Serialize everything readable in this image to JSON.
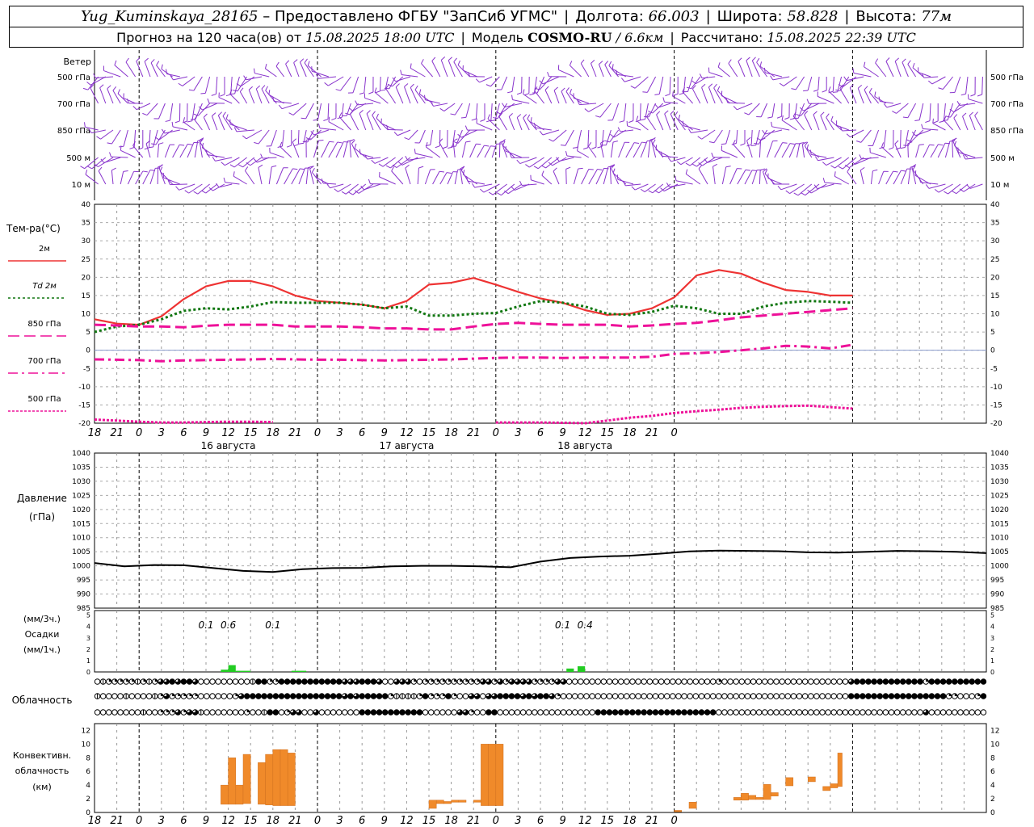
{
  "header": {
    "station": "Yug_Kuminskaya_28165",
    "provider_text": "– Предоставлено ФГБУ \"ЗапСиб УГМС\"",
    "lon_label": "Долгота:",
    "lon_value": "66.003",
    "lat_label": "Широта:",
    "lat_value": "58.828",
    "alt_label": "Высота:",
    "alt_value": "77м",
    "forecast_label": "Прогноз на 120 часа(ов) от",
    "forecast_start": "15.08.2025 18:00 UTC",
    "model_label": "Модель",
    "model_name": "COSMO-RU",
    "model_res": "/ 6.6км",
    "computed_label": "Рассчитано:",
    "computed_value": "15.08.2025 22:39 UTC"
  },
  "chart_data": [
    {
      "type": "barbs",
      "title": "Ветер",
      "levels": [
        "500 гПа",
        "700 гПа",
        "850 гПа",
        "500 м",
        "10 м"
      ]
    },
    {
      "type": "line",
      "title": "Тем-ра(°С)",
      "x": [
        18,
        21,
        24,
        27,
        30,
        33,
        36,
        39,
        42,
        45,
        48,
        51,
        54,
        57,
        60,
        63,
        66,
        69,
        72,
        75,
        78,
        81,
        84,
        87,
        90,
        93,
        96,
        99,
        102,
        105,
        108,
        111,
        114,
        117,
        120,
        123,
        126,
        129,
        132,
        135,
        138,
        141,
        144
      ],
      "ylim": [
        -20,
        40
      ],
      "yticks": [
        -20,
        -15,
        -10,
        -5,
        0,
        5,
        10,
        15,
        20,
        25,
        30,
        35,
        40
      ],
      "series": [
        {
          "name": "2м",
          "color": "#ee3333",
          "dash": "solid",
          "values": [
            8.5,
            7.3,
            7.0,
            9.3,
            14.0,
            17.5,
            19.0,
            19.0,
            17.5,
            15.0,
            13.5,
            13.0,
            12.5,
            11.5,
            13.5,
            18.0,
            18.5,
            19.8,
            18.0,
            16.0,
            14.2,
            13.0,
            11.0,
            9.7,
            10.0,
            11.5,
            14.5,
            20.5,
            22.0,
            21.0,
            18.5,
            16.5,
            16.0,
            15.0,
            15.0
          ]
        },
        {
          "name": "Td 2м",
          "color": "#117711",
          "dash": "dot",
          "values": [
            5.0,
            6.5,
            7.0,
            8.5,
            10.8,
            11.5,
            11.2,
            12.0,
            13.2,
            13.0,
            13.0,
            13.0,
            12.5,
            11.5,
            12.0,
            9.5,
            9.5,
            10.0,
            10.2,
            12.0,
            13.5,
            13.0,
            12.0,
            10.0,
            9.7,
            10.5,
            12.2,
            11.5,
            10.0,
            10.0,
            12.0,
            13.0,
            13.5,
            13.3,
            13.0
          ]
        },
        {
          "name": "850 гПа",
          "color": "#ee1199",
          "dash": "longdash",
          "values": [
            7.0,
            6.8,
            6.5,
            6.5,
            6.3,
            6.7,
            7.0,
            7.0,
            7.0,
            6.5,
            6.5,
            6.5,
            6.3,
            6.0,
            6.0,
            5.7,
            5.7,
            6.5,
            7.2,
            7.5,
            7.2,
            7.0,
            7.0,
            7.0,
            6.5,
            6.8,
            7.2,
            7.5,
            8.2,
            9.0,
            9.5,
            10.0,
            10.5,
            11.0,
            11.5
          ]
        },
        {
          "name": "700 гПа",
          "color": "#ee1199",
          "dash": "dashdot",
          "values": [
            -2.5,
            -2.6,
            -2.7,
            -3.0,
            -2.8,
            -2.7,
            -2.6,
            -2.5,
            -2.4,
            -2.5,
            -2.6,
            -2.6,
            -2.7,
            -2.8,
            -2.7,
            -2.6,
            -2.5,
            -2.3,
            -2.1,
            -2.0,
            -2.0,
            -2.1,
            -2.0,
            -2.0,
            -2.0,
            -1.8,
            -1.0,
            -0.8,
            -0.5,
            0.0,
            0.5,
            1.2,
            1.0,
            0.5,
            1.5
          ]
        },
        {
          "name": "500 гПа",
          "color": "#ee1199",
          "dash": "shortdash",
          "values": [
            -19.0,
            -19.3,
            -19.6,
            -19.8,
            -19.8,
            -19.7,
            -19.6,
            -19.6,
            -19.7,
            null,
            null,
            null,
            null,
            null,
            null,
            null,
            null,
            null,
            -19.8,
            -19.8,
            -19.8,
            -19.9,
            -20.0,
            -19.3,
            -18.5,
            -18.0,
            -17.2,
            -16.7,
            -16.3,
            -15.8,
            -15.5,
            -15.3,
            -15.2,
            -15.6,
            -16.0
          ]
        }
      ]
    },
    {
      "type": "line",
      "title": "Давление",
      "unit": "(гПа)",
      "ylim": [
        985,
        1040
      ],
      "yticks": [
        985,
        990,
        995,
        1000,
        1005,
        1010,
        1015,
        1020,
        1025,
        1030,
        1035,
        1040
      ],
      "series": [
        {
          "name": "Давление",
          "color": "#000000",
          "values": [
            1001.0,
            999.8,
            1000.3,
            1000.2,
            999.2,
            998.2,
            997.8,
            998.8,
            999.2,
            999.3,
            999.8,
            1000.0,
            1000.0,
            999.8,
            999.5,
            1001.5,
            1002.8,
            1003.3,
            1003.6,
            1004.3,
            1005.1,
            1005.4,
            1005.3,
            1005.2,
            1004.8,
            1004.7,
            1005.0,
            1005.3,
            1005.2,
            1005.0,
            1004.5
          ]
        }
      ]
    },
    {
      "type": "bar",
      "title": "Осадки",
      "unit_top": "(мм/3ч.)",
      "unit_bottom": "(мм/1ч.)",
      "ylim": [
        0,
        5
      ],
      "yticks": [
        0,
        1,
        2,
        3,
        4,
        5
      ],
      "hourly": [
        {
          "x": 35.5,
          "value": 0.2
        },
        {
          "x": 36.5,
          "value": 0.6
        },
        {
          "x": 37.5,
          "value": 0.1
        },
        {
          "x": 38.5,
          "value": 0.1
        },
        {
          "x": 45.0,
          "value": 0.1
        },
        {
          "x": 46.0,
          "value": 0.1
        },
        {
          "x": 82.0,
          "value": 0.3
        },
        {
          "x": 83.5,
          "value": 0.5
        }
      ],
      "sums_3h": [
        {
          "x": 33,
          "label": "0.1"
        },
        {
          "x": 36,
          "label": "0.6"
        },
        {
          "x": 42,
          "label": "0.1"
        },
        {
          "x": 81,
          "label": "0.1"
        },
        {
          "x": 84,
          "label": "0.4"
        }
      ]
    },
    {
      "type": "table",
      "title": "Облачность",
      "rows": [
        [
          0,
          1,
          2,
          2,
          2,
          2,
          2,
          1,
          2,
          1,
          2,
          3,
          3,
          4,
          3,
          4,
          4,
          3,
          0,
          0,
          0,
          0,
          0,
          0,
          0,
          0,
          0,
          1,
          4,
          4,
          2,
          2,
          4,
          4,
          4,
          4,
          4,
          4,
          4,
          4,
          4,
          4,
          4,
          3,
          3,
          3,
          4,
          4,
          4,
          3,
          0,
          0,
          3,
          3,
          3,
          2,
          0,
          2,
          2,
          2,
          2,
          2,
          2,
          2,
          2,
          2,
          2,
          3,
          3,
          2,
          3,
          2,
          3,
          3,
          3,
          3,
          2,
          2,
          2,
          2,
          3,
          3,
          0,
          0,
          0,
          0,
          0,
          0,
          0,
          0,
          0,
          0,
          0,
          0,
          0,
          0,
          0,
          0,
          0,
          0,
          0,
          0,
          0,
          0,
          0,
          0,
          0,
          0,
          2,
          0,
          0,
          0,
          0,
          0,
          0,
          0,
          0,
          0,
          0,
          0,
          0,
          0,
          0,
          0,
          0,
          0,
          0,
          0,
          0,
          0,
          0,
          3,
          4,
          4,
          4,
          4,
          4,
          4,
          4,
          4,
          4,
          4,
          4,
          4,
          2,
          4,
          4,
          4,
          4,
          4,
          4,
          4,
          4,
          4,
          4
        ],
        [
          1,
          0,
          0,
          0,
          0,
          1,
          0,
          0,
          0,
          0,
          1,
          2,
          3,
          2,
          2,
          2,
          2,
          2,
          0,
          0,
          0,
          0,
          0,
          0,
          2,
          3,
          4,
          4,
          4,
          4,
          4,
          4,
          4,
          4,
          4,
          4,
          4,
          4,
          4,
          4,
          4,
          4,
          4,
          3,
          4,
          3,
          4,
          4,
          4,
          4,
          4,
          2,
          1,
          1,
          1,
          1,
          2,
          4,
          2,
          2,
          2,
          4,
          2,
          0,
          0,
          3,
          3,
          0,
          3,
          3,
          4,
          4,
          4,
          4,
          3,
          4,
          3,
          4,
          4,
          3,
          2,
          0,
          0,
          0,
          0,
          0,
          0,
          0,
          0,
          0,
          0,
          0,
          0,
          0,
          0,
          0,
          0,
          0,
          0,
          0,
          0,
          0,
          0,
          0,
          0,
          0,
          0,
          0,
          0,
          0,
          0,
          0,
          0,
          0,
          0,
          0,
          0,
          0,
          0,
          0,
          0,
          0,
          0,
          0,
          0,
          0,
          0,
          0,
          0,
          0,
          0,
          4,
          4,
          4,
          4,
          4,
          4,
          4,
          4,
          4,
          4,
          4,
          4,
          4,
          4,
          4,
          4,
          4,
          2,
          2,
          0,
          0,
          0,
          2,
          4
        ],
        [
          0,
          0,
          0,
          0,
          0,
          0,
          0,
          0,
          1,
          0,
          0,
          2,
          2,
          2,
          3,
          2,
          3,
          3,
          1,
          0,
          0,
          0,
          0,
          0,
          0,
          0,
          2,
          0,
          0,
          1,
          4,
          4,
          0,
          2,
          3,
          3,
          0,
          0,
          3,
          0,
          0,
          0,
          0,
          0,
          0,
          0,
          4,
          4,
          4,
          4,
          4,
          4,
          4,
          4,
          4,
          4,
          4,
          0,
          0,
          0,
          0,
          0,
          0,
          3,
          3,
          2,
          0,
          0,
          4,
          4,
          0,
          0,
          0,
          0,
          0,
          0,
          0,
          0,
          0,
          0,
          0,
          0,
          0,
          0,
          0,
          0,
          0,
          4,
          4,
          4,
          4,
          4,
          4,
          4,
          4,
          4,
          4,
          4,
          4,
          4,
          4,
          4,
          4,
          4,
          4,
          4,
          4,
          4,
          0,
          0,
          0,
          0,
          0,
          0,
          0,
          0,
          0,
          0,
          0,
          0,
          0,
          0,
          0,
          0,
          0,
          0,
          0,
          0,
          0,
          0,
          0,
          0,
          0,
          0,
          0,
          0,
          0,
          0,
          0,
          0,
          0,
          0,
          0,
          0,
          3,
          0,
          0,
          0,
          0,
          0,
          0,
          0,
          0,
          0,
          0
        ]
      ]
    },
    {
      "type": "bar",
      "title": "Конвективн. облачность",
      "unit": "(км)",
      "ylim": [
        0,
        13
      ],
      "yticks": [
        0,
        2,
        4,
        6,
        8,
        10,
        12
      ],
      "bars": [
        {
          "x0": 35.0,
          "x1": 36.0,
          "base": 1.2,
          "top": 4.0
        },
        {
          "x0": 36.0,
          "x1": 37.0,
          "base": 1.2,
          "top": 8.0
        },
        {
          "x0": 37.0,
          "x1": 38.0,
          "base": 1.2,
          "top": 4.0
        },
        {
          "x0": 38.0,
          "x1": 39.0,
          "base": 1.3,
          "top": 8.5
        },
        {
          "x0": 40.0,
          "x1": 41.0,
          "base": 1.2,
          "top": 7.3
        },
        {
          "x0": 41.0,
          "x1": 42.0,
          "base": 1.1,
          "top": 8.5
        },
        {
          "x0": 42.0,
          "x1": 43.0,
          "base": 1.0,
          "top": 9.2
        },
        {
          "x0": 43.0,
          "x1": 44.0,
          "base": 1.0,
          "top": 9.2
        },
        {
          "x0": 44.0,
          "x1": 45.0,
          "base": 1.0,
          "top": 8.7
        },
        {
          "x0": 63.0,
          "x1": 64.0,
          "base": 0.6,
          "top": 1.8
        },
        {
          "x0": 64.0,
          "x1": 65.0,
          "base": 1.3,
          "top": 1.8
        },
        {
          "x0": 65.0,
          "x1": 66.0,
          "base": 1.3,
          "top": 1.6
        },
        {
          "x0": 66.0,
          "x1": 67.0,
          "base": 1.5,
          "top": 1.8
        },
        {
          "x0": 67.0,
          "x1": 68.0,
          "base": 1.5,
          "top": 1.8
        },
        {
          "x0": 69.0,
          "x1": 70.0,
          "base": 1.5,
          "top": 1.8
        },
        {
          "x0": 70.0,
          "x1": 71.0,
          "base": 1.0,
          "top": 10.0
        },
        {
          "x0": 71.0,
          "x1": 72.0,
          "base": 1.0,
          "top": 10.0
        },
        {
          "x0": 72.0,
          "x1": 73.0,
          "base": 1.0,
          "top": 10.0
        },
        {
          "x0": 96.0,
          "x1": 97.0,
          "base": 0.1,
          "top": 0.3
        },
        {
          "x0": 98.0,
          "x1": 99.0,
          "base": 0.6,
          "top": 1.5
        },
        {
          "x0": 104.0,
          "x1": 105.0,
          "base": 1.8,
          "top": 2.2
        },
        {
          "x0": 105.0,
          "x1": 106.0,
          "base": 1.8,
          "top": 2.8
        },
        {
          "x0": 106.0,
          "x1": 107.0,
          "base": 1.9,
          "top": 2.5
        },
        {
          "x0": 107.0,
          "x1": 108.0,
          "base": 1.9,
          "top": 2.2
        },
        {
          "x0": 108.0,
          "x1": 109.0,
          "base": 1.9,
          "top": 4.1
        },
        {
          "x0": 109.0,
          "x1": 110.0,
          "base": 2.4,
          "top": 2.9
        },
        {
          "x0": 111.0,
          "x1": 112.0,
          "base": 3.9,
          "top": 5.1
        },
        {
          "x0": 114.0,
          "x1": 115.0,
          "base": 4.5,
          "top": 5.2
        },
        {
          "x0": 116.0,
          "x1": 117.0,
          "base": 3.2,
          "top": 3.8
        },
        {
          "x0": 117.0,
          "x1": 118.0,
          "base": 3.6,
          "top": 4.2
        },
        {
          "x0": 118.0,
          "x1": 118.6,
          "base": 3.8,
          "top": 8.7
        }
      ]
    }
  ],
  "axis": {
    "hour_labels": [
      "18",
      "21",
      "0",
      "3",
      "6",
      "9",
      "12",
      "15",
      "18",
      "21",
      "0",
      "3",
      "6",
      "9",
      "12",
      "15",
      "18",
      "21",
      "0",
      "3",
      "6",
      "9",
      "12",
      "15",
      "18",
      "21",
      "0"
    ],
    "days": [
      {
        "x": 36,
        "label": "16 августа"
      },
      {
        "x": 60,
        "label": "17 августа"
      },
      {
        "x": 84,
        "label": "18 августа"
      }
    ]
  },
  "colors": {
    "wind": "#8833cc",
    "precip": "#22cc22",
    "convective": "#f08a2a",
    "grid": "#888888"
  }
}
